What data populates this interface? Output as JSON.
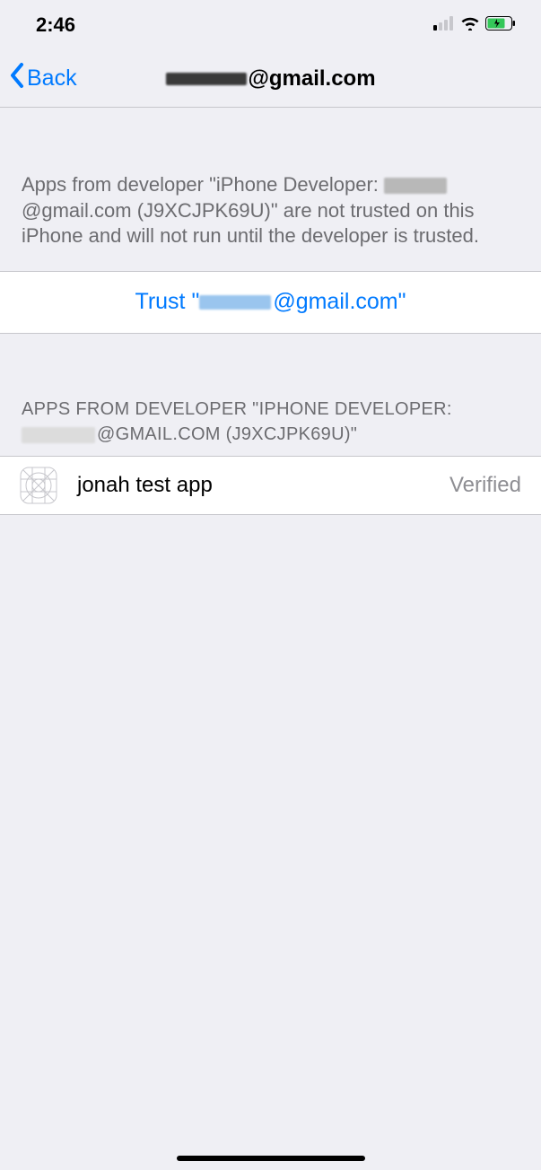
{
  "status_bar": {
    "time": "2:46"
  },
  "nav": {
    "back_label": "Back",
    "title_suffix": "@gmail.com"
  },
  "info": {
    "text_prefix": "Apps from developer \"iPhone Developer: ",
    "text_mid": "@gmail.com (J9XCJPK69U)\" are not trusted on this iPhone and will not run until the developer is trusted."
  },
  "trust": {
    "label_prefix": "Trust \"",
    "label_suffix": "@gmail.com\""
  },
  "section": {
    "header_prefix": "APPS FROM DEVELOPER \"IPHONE DEVELOPER: ",
    "header_suffix": "@GMAIL.COM (J9XCJPK69U)\""
  },
  "apps": [
    {
      "name": "jonah test app",
      "status": "Verified"
    }
  ]
}
